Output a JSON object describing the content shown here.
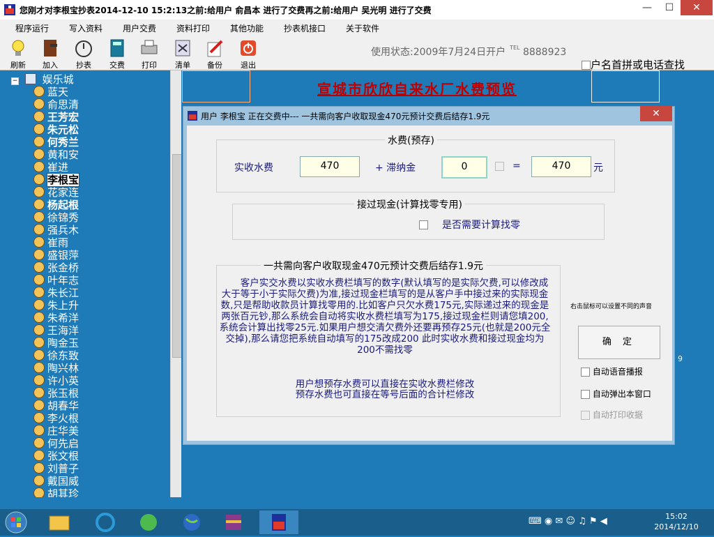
{
  "window": {
    "title": "您刚才对李根宝抄表2014-12-10 15:2:13之前:给用户 俞昌本 进行了交费再之前:给用户 吴光明 进行了交费",
    "minimize": "—",
    "maximize": "☐",
    "close": "✕"
  },
  "menu": [
    "程序运行",
    "写入资料",
    "用户交费",
    "资料打印",
    "其他功能",
    "抄表机接口",
    "关于软件"
  ],
  "toolbar": [
    "刷新",
    "加入",
    "抄表",
    "交费",
    "打印",
    "清单",
    "备份",
    "退出"
  ],
  "status": {
    "text": "使用状态:2009年7月24日开户",
    "tel_label": "TEL",
    "tel": "8888923"
  },
  "search": {
    "label": "户名首拼或电话查找"
  },
  "tree": {
    "root": "娱乐城",
    "items": [
      "蓝天",
      "俞思清",
      "王芳宏",
      "朱元松",
      "何秀兰",
      "黄和安",
      "崔进",
      "李根宝",
      "花家连",
      "杨起根",
      "徐锦秀",
      "强兵木",
      "崔雨",
      "盛银萍",
      "张金桥",
      "叶年志",
      "朱长江",
      "朱上升",
      "朱希洋",
      "王海洋",
      "陶金玉",
      "徐东致",
      "陶兴林",
      "许小英",
      "张玉根",
      "胡春华",
      "李火根",
      "庄华美",
      "何先启",
      "张文根",
      "刘普子",
      "戴国威",
      "胡其珍"
    ]
  },
  "preview": {
    "title": "宣城市欣欣自来水厂水费预览",
    "side_digit": "9"
  },
  "dialog": {
    "title": "用户 李根宝 正在交费中--- 一共需向客户收取现金470元预计交费后结存1.9元",
    "close": "✕",
    "water_group": "水费(预存)",
    "actual_label": "实收水费",
    "actual_value": "470",
    "plus_late": "+ 滞纳金",
    "late_value": "0",
    "equals": "=",
    "total_value": "470",
    "yuan": "元",
    "cash_group": "接过现金(计算找零专用)",
    "change_label": "是否需要计算找零",
    "summary": "一共需向客户收取现金470元预计交费后结存1.9元",
    "para1": "客户实交水费以实收水费栏填写的数字(默认填写的是实际欠费,可以修改成大于等于小于实际欠费)为准,接过现金栏填写的是从客户手中接过来的实际现金数,只是帮助收款员计算找零用的.比如客户只欠水费175元,实际递过来的现金是两张百元钞,那么系统会自动将实收水费栏填写为175,接过现金栏则请您填200,系统会计算出找零25元.如果用户想交清欠费外还要再预存25元(也就是200元全交掉),那么请您把系统自动填写的175改成200 此时实收水费和接过现金均为200不需找零",
    "para2a": "用户想预存水费可以直接在实收水费栏修改",
    "para2b": "预存水费也可直接在等号后面的合计栏修改",
    "hint": "右击鼠标可以设置不同的声音",
    "confirm": "确 定",
    "opt_voice": "自动语音播报",
    "opt_popup": "自动弹出本窗口",
    "opt_print": "自动打印收据"
  },
  "clock": {
    "time": "15:02",
    "date": "2014/12/10"
  }
}
